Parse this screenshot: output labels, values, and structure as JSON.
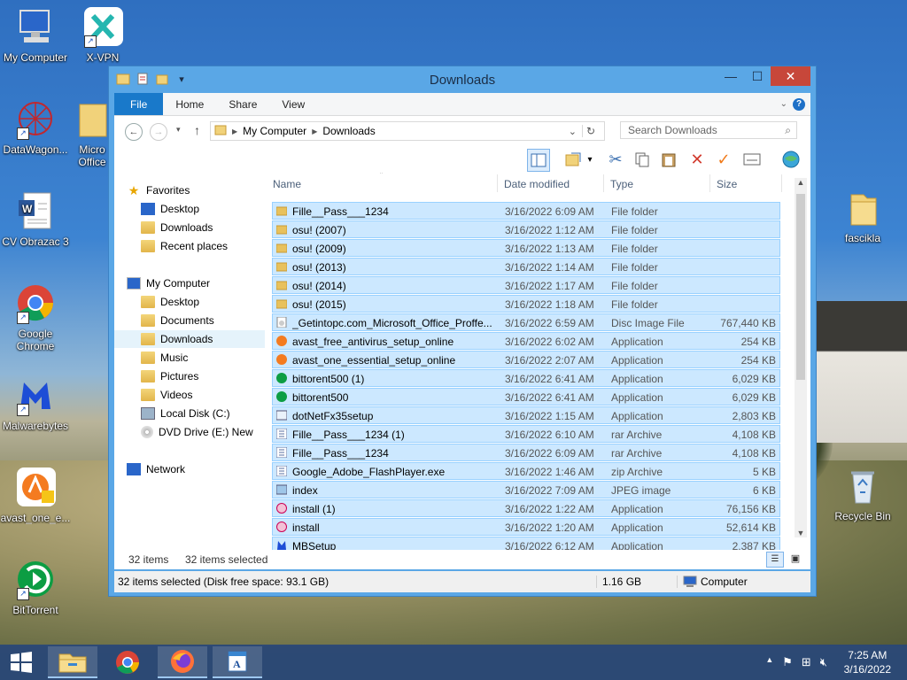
{
  "desktop": {
    "icons": [
      {
        "label": "My Computer"
      },
      {
        "label": "X-VPN"
      },
      {
        "label": "DataWagon..."
      },
      {
        "label": "Micro Office"
      },
      {
        "label": "CV Obrazac 3"
      },
      {
        "label": "Google Chrome"
      },
      {
        "label": "Malwarebytes"
      },
      {
        "label": "avast_one_e..."
      },
      {
        "label": "BitTorrent"
      },
      {
        "label": "fascikla"
      },
      {
        "label": "Recycle Bin"
      }
    ]
  },
  "window": {
    "title": "Downloads",
    "ribbon_tabs": [
      "File",
      "Home",
      "Share",
      "View"
    ],
    "address": {
      "parts": [
        "My Computer",
        "Downloads"
      ]
    },
    "search_placeholder": "Search Downloads",
    "nav": {
      "favorites": "Favorites",
      "favorites_items": [
        "Desktop",
        "Downloads",
        "Recent places"
      ],
      "computer": "My Computer",
      "computer_items": [
        "Desktop",
        "Documents",
        "Downloads",
        "Music",
        "Pictures",
        "Videos",
        "Local Disk (C:)",
        "DVD Drive (E:) New"
      ],
      "network": "Network"
    },
    "columns": {
      "name": "Name",
      "date": "Date modified",
      "type": "Type",
      "size": "Size"
    },
    "files": [
      {
        "name": "Fille__Pass___1234",
        "date": "3/16/2022 6:09 AM",
        "type": "File folder",
        "size": ""
      },
      {
        "name": "osu! (2007)",
        "date": "3/16/2022 1:12 AM",
        "type": "File folder",
        "size": ""
      },
      {
        "name": "osu! (2009)",
        "date": "3/16/2022 1:13 AM",
        "type": "File folder",
        "size": ""
      },
      {
        "name": "osu! (2013)",
        "date": "3/16/2022 1:14 AM",
        "type": "File folder",
        "size": ""
      },
      {
        "name": "osu! (2014)",
        "date": "3/16/2022 1:17 AM",
        "type": "File folder",
        "size": ""
      },
      {
        "name": "osu! (2015)",
        "date": "3/16/2022 1:18 AM",
        "type": "File folder",
        "size": ""
      },
      {
        "name": "_Getintopc.com_Microsoft_Office_Proffe...",
        "date": "3/16/2022 6:59 AM",
        "type": "Disc Image File",
        "size": "767,440 KB"
      },
      {
        "name": "avast_free_antivirus_setup_online",
        "date": "3/16/2022 6:02 AM",
        "type": "Application",
        "size": "254 KB"
      },
      {
        "name": "avast_one_essential_setup_online",
        "date": "3/16/2022 2:07 AM",
        "type": "Application",
        "size": "254 KB"
      },
      {
        "name": "bittorent500 (1)",
        "date": "3/16/2022 6:41 AM",
        "type": "Application",
        "size": "6,029 KB"
      },
      {
        "name": "bittorent500",
        "date": "3/16/2022 6:41 AM",
        "type": "Application",
        "size": "6,029 KB"
      },
      {
        "name": "dotNetFx35setup",
        "date": "3/16/2022 1:15 AM",
        "type": "Application",
        "size": "2,803 KB"
      },
      {
        "name": "Fille__Pass___1234 (1)",
        "date": "3/16/2022 6:10 AM",
        "type": "rar Archive",
        "size": "4,108 KB"
      },
      {
        "name": "Fille__Pass___1234",
        "date": "3/16/2022 6:09 AM",
        "type": "rar Archive",
        "size": "4,108 KB"
      },
      {
        "name": "Google_Adobe_FlashPlayer.exe",
        "date": "3/16/2022 1:46 AM",
        "type": "zip Archive",
        "size": "5 KB"
      },
      {
        "name": "index",
        "date": "3/16/2022 7:09 AM",
        "type": "JPEG image",
        "size": "6 KB"
      },
      {
        "name": "install (1)",
        "date": "3/16/2022 1:22 AM",
        "type": "Application",
        "size": "76,156 KB"
      },
      {
        "name": "install",
        "date": "3/16/2022 1:20 AM",
        "type": "Application",
        "size": "52,614 KB"
      },
      {
        "name": "MBSetup",
        "date": "3/16/2022 6:12 AM",
        "type": "Application",
        "size": "2,387 KB"
      }
    ],
    "info": {
      "count": "32 items",
      "selected": "32 items selected"
    },
    "status": {
      "left": "32 items selected (Disk free space: 93.1 GB)",
      "size": "1.16 GB",
      "location": "Computer"
    }
  },
  "taskbar": {
    "time": "7:25 AM",
    "date": "3/16/2022"
  }
}
